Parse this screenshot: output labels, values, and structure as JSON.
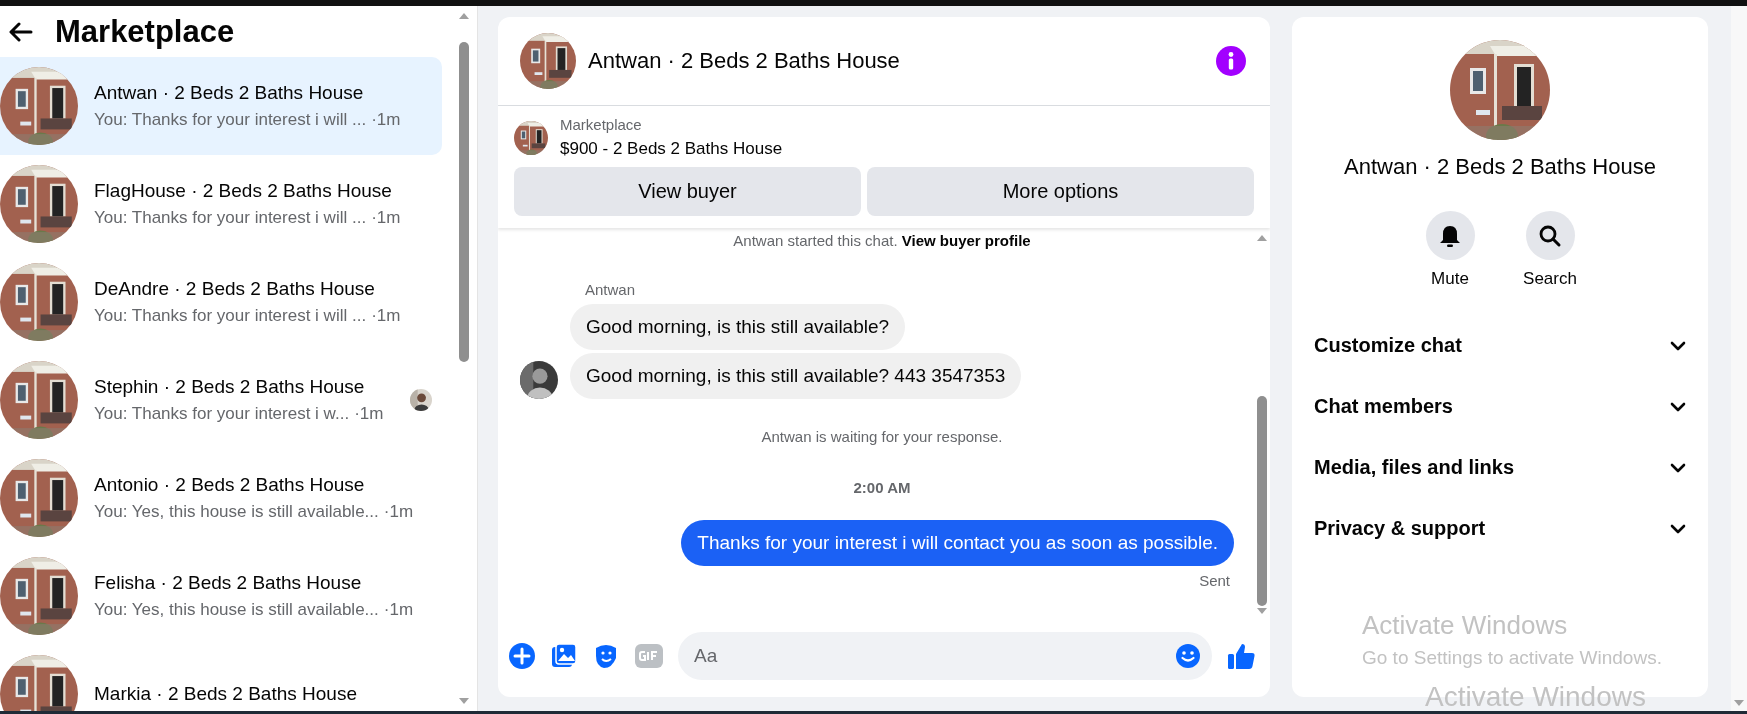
{
  "sidebar": {
    "title": "Marketplace",
    "conversations": [
      {
        "name": "Antwan · 2 Beds 2 Baths House",
        "preview": "You: Thanks for your interest i will ...",
        "time": "·1m",
        "selected": true,
        "read_receipt": false
      },
      {
        "name": "FlagHouse · 2 Beds 2 Baths House",
        "preview": "You: Thanks for your interest i will ...",
        "time": "·1m",
        "selected": false,
        "read_receipt": false
      },
      {
        "name": "DeAndre · 2 Beds 2 Baths House",
        "preview": "You: Thanks for your interest i will ...",
        "time": "·1m",
        "selected": false,
        "read_receipt": false
      },
      {
        "name": "Stephin · 2 Beds 2 Baths House",
        "preview": "You: Thanks for your interest i w...",
        "time": "·1m",
        "selected": false,
        "read_receipt": true
      },
      {
        "name": "Antonio · 2 Beds 2 Baths House",
        "preview": "You: Yes, this house is still available...",
        "time": "·1m",
        "selected": false,
        "read_receipt": false
      },
      {
        "name": "Felisha · 2 Beds 2 Baths House",
        "preview": "You: Yes, this house is still available...",
        "time": "·1m",
        "selected": false,
        "read_receipt": false
      },
      {
        "name": "Markia · 2 Beds 2 Baths House",
        "selected": false,
        "read_receipt": false
      }
    ]
  },
  "chat": {
    "title": "Antwan · 2 Beds 2 Baths House",
    "listing": {
      "source": "Marketplace",
      "title": "$900 - 2 Beds 2 Baths House"
    },
    "buttons": [
      "View buyer",
      "More options"
    ],
    "messages": [
      {
        "kind": "notice",
        "text": "Antwan started this chat.",
        "link": "View buyer profile"
      },
      {
        "kind": "sender",
        "text": "Antwan"
      },
      {
        "kind": "incoming",
        "text": "Good morning, is this still available?",
        "avatar": false
      },
      {
        "kind": "incoming",
        "text": "Good morning, is this still available? 443 3547353",
        "avatar": true
      },
      {
        "kind": "notice",
        "text": "Antwan is waiting for your response."
      },
      {
        "kind": "time",
        "text": "2:00 AM"
      },
      {
        "kind": "outgoing",
        "text": "Thanks for your interest i will contact you as soon as possible."
      },
      {
        "kind": "status",
        "text": "Sent"
      }
    ],
    "composer": {
      "placeholder": "Aa"
    }
  },
  "details": {
    "name": "Antwan · 2 Beds 2 Baths House",
    "actions": [
      {
        "kind": "mute",
        "label": "Mute"
      },
      {
        "kind": "search",
        "label": "Search"
      }
    ],
    "sections": [
      {
        "label": "Customize chat",
        "expanded": false
      },
      {
        "label": "Chat members",
        "expanded": false
      },
      {
        "label": "Media, files and links",
        "expanded": false
      },
      {
        "label": "Privacy & support",
        "expanded": false
      }
    ]
  },
  "os_notice": {
    "title": "Activate Windows",
    "hint": "Go to Settings to activate Windows.",
    "repeat_title": "Activate Windows"
  }
}
